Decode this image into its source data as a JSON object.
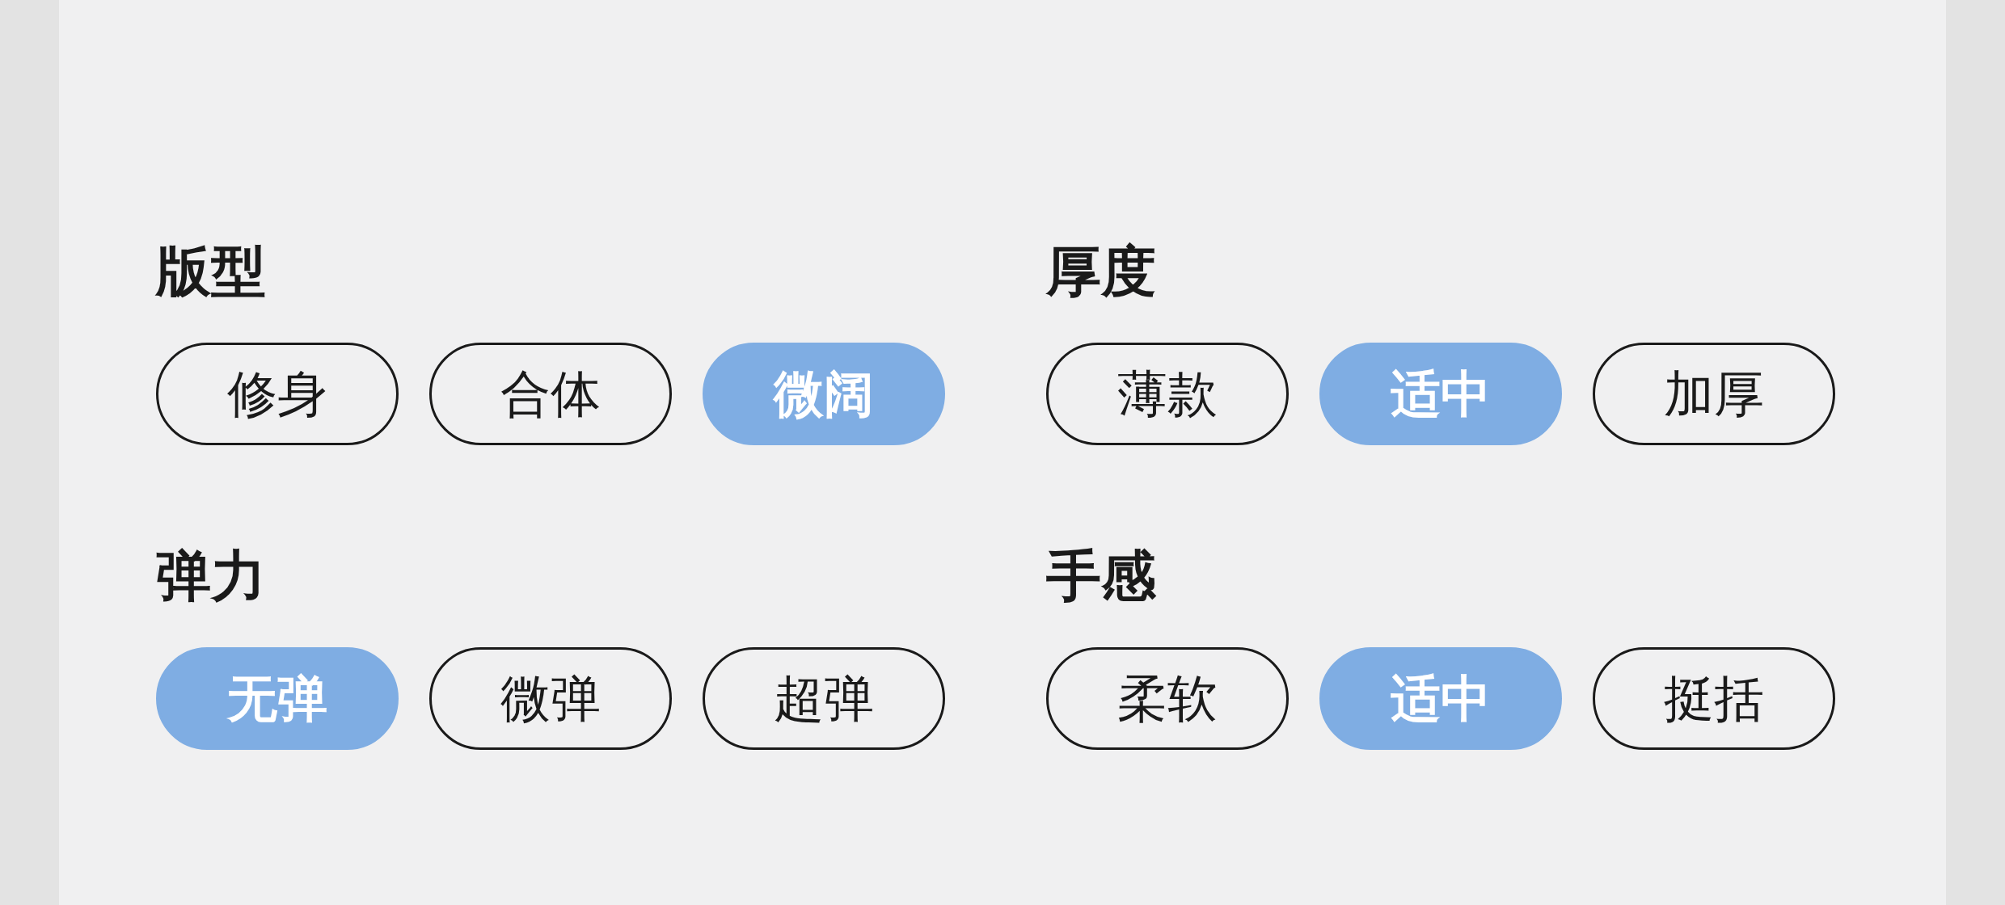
{
  "sections": [
    {
      "label": "版型",
      "options": [
        {
          "label": "修身",
          "selected": false
        },
        {
          "label": "合体",
          "selected": false
        },
        {
          "label": "微阔",
          "selected": true
        }
      ]
    },
    {
      "label": "厚度",
      "options": [
        {
          "label": "薄款",
          "selected": false
        },
        {
          "label": "适中",
          "selected": true
        },
        {
          "label": "加厚",
          "selected": false
        }
      ]
    },
    {
      "label": "弹力",
      "options": [
        {
          "label": "无弹",
          "selected": true
        },
        {
          "label": "微弹",
          "selected": false
        },
        {
          "label": "超弹",
          "selected": false
        }
      ]
    },
    {
      "label": "手感",
      "options": [
        {
          "label": "柔软",
          "selected": false
        },
        {
          "label": "适中",
          "selected": true
        },
        {
          "label": "挺括",
          "selected": false
        }
      ]
    }
  ]
}
